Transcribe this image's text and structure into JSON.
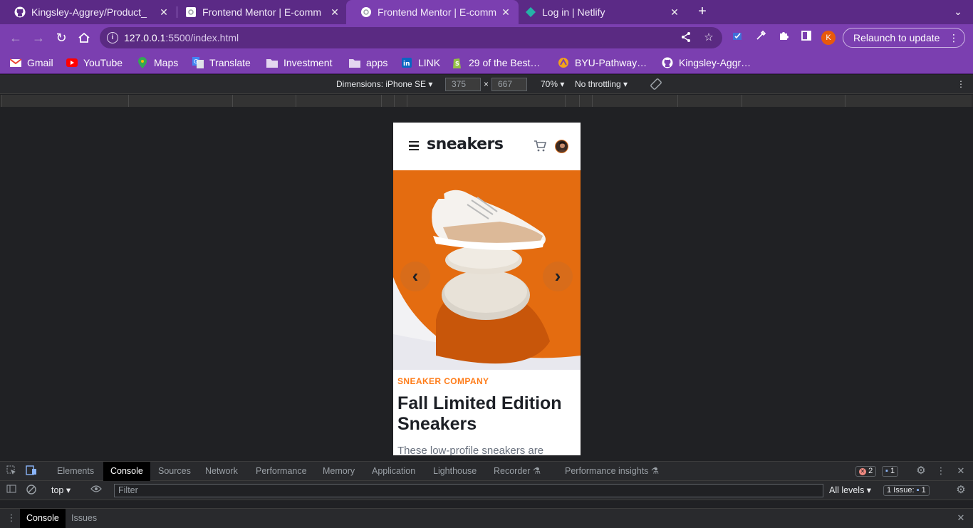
{
  "tabs": [
    {
      "title": "Kingsley-Aggrey/Product_",
      "icon": "github-icon"
    },
    {
      "title": "Frontend Mentor | E-comm",
      "icon": "page-icon"
    },
    {
      "title": "Frontend Mentor | E-comm",
      "icon": "page-icon",
      "active": true
    },
    {
      "title": "Log in | Netlify",
      "icon": "netlify-icon"
    }
  ],
  "address": {
    "host": "127.0.0.1",
    "path": ":5500/index.html"
  },
  "profile_initial": "K",
  "relaunch_label": "Relaunch to update",
  "bookmarks": [
    "Gmail",
    "YouTube",
    "Maps",
    "Translate",
    "Investment",
    "apps",
    "LINK",
    "29 of the Best…",
    "BYU-Pathway…",
    "Kingsley-Aggr…"
  ],
  "device_toolbar": {
    "dimensions_label": "Dimensions: iPhone SE",
    "width": "375",
    "times": "×",
    "height": "667",
    "zoom": "70%",
    "throttling": "No throttling"
  },
  "site": {
    "logo": "sneakers",
    "company": "SNEAKER COMPANY",
    "title": "Fall Limited Edition Sneakers",
    "description": "These low-profile sneakers are",
    "prev_arrow": "‹",
    "next_arrow": "›"
  },
  "devtools": {
    "tabs": [
      "Elements",
      "Console",
      "Sources",
      "Network",
      "Performance",
      "Memory",
      "Application",
      "Lighthouse",
      "Recorder",
      "Performance insights"
    ],
    "active_tab": "Console",
    "error_count": "2",
    "message_count": "1",
    "context": "top",
    "filter_placeholder": "Filter",
    "levels": "All levels",
    "issues_label": "1 Issue:",
    "issues_count": "1",
    "drawer_tabs": [
      "Console",
      "Issues"
    ]
  },
  "colors": {
    "brand_orange": "#ff7d1a",
    "chrome_purple": "#7b3fb0"
  }
}
